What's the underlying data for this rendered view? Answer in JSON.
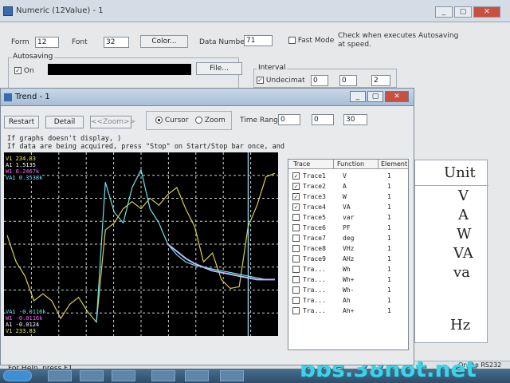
{
  "numeric_window": {
    "title": "Numeric (12Value) - 1",
    "win_buttons": [
      "_",
      "▢",
      "✕"
    ],
    "font_label": "Font",
    "font_value": "32",
    "form_label": "Form",
    "form_value": "12",
    "color_button": "Color...",
    "data_number_label": "Data Number",
    "data_number_value": "71",
    "fast_mode_label": "Fast Mode",
    "autosave_note": "Check when executes Autosaving at speed.",
    "autosaving_group": "Autosaving",
    "autosave_check_label": "On",
    "file_button": "File...",
    "interval_group": "Interval",
    "undecimated_label": "Undecimat",
    "interval_values": [
      "0",
      "0",
      "2"
    ],
    "unit_header": "Unit",
    "units": [
      "V",
      "A",
      "W",
      "VA",
      "va",
      "Hz"
    ],
    "status_help": "For Help, press F1",
    "status_online": "Online",
    "status_port": "RS232"
  },
  "trend_window": {
    "title": "Trend - 1",
    "buttons": {
      "restart": "Restart",
      "detail": "Detail",
      "zoom": "<<Zoom>>"
    },
    "mode": {
      "cursor": "Cursor",
      "zoom": "Zoom",
      "selected": "cursor"
    },
    "time_range_label": "Time Range",
    "time_range_values": [
      "0",
      "0",
      "30"
    ],
    "hint_line1": "If graphs doesn't display, )",
    "hint_line2": "If data are being acquired,  press \"Stop\" on Start/Stop bar once, and",
    "readouts_top": [
      {
        "text": "V1 234.83",
        "color": "#f2ee5a"
      },
      {
        "text": "A1 1.5135",
        "color": "#ffffff"
      },
      {
        "text": "W1 0.2467k",
        "color": "#ff66ff"
      },
      {
        "text": "VA1 0.3538k",
        "color": "#6ee8ff"
      }
    ],
    "readouts_bottom": [
      {
        "text": "VA1 -0.0116k",
        "color": "#6ee8ff"
      },
      {
        "text": "W1 -0.0116k",
        "color": "#ff66ff"
      },
      {
        "text": "A1 -0.0124",
        "color": "#ffffff"
      },
      {
        "text": "V1 233.83",
        "color": "#f2ee5a"
      }
    ],
    "trace_table": {
      "headers": [
        "Trace",
        "Function",
        "Element"
      ],
      "rows": [
        {
          "trace": "Trace1",
          "function": "V",
          "element": "1",
          "checked": true
        },
        {
          "trace": "Trace2",
          "function": "A",
          "element": "1",
          "checked": true
        },
        {
          "trace": "Trace3",
          "function": "W",
          "element": "1",
          "checked": true
        },
        {
          "trace": "Trace4",
          "function": "VA",
          "element": "1",
          "checked": true
        },
        {
          "trace": "Trace5",
          "function": "var",
          "element": "1",
          "checked": false
        },
        {
          "trace": "Trace6",
          "function": "PF",
          "element": "1",
          "checked": false
        },
        {
          "trace": "Trace7",
          "function": "deg",
          "element": "1",
          "checked": false
        },
        {
          "trace": "Trace8",
          "function": "VHz",
          "element": "1",
          "checked": false
        },
        {
          "trace": "Trace9",
          "function": "AHz",
          "element": "1",
          "checked": false
        },
        {
          "trace": "Tra...",
          "function": "Wh",
          "element": "1",
          "checked": false
        },
        {
          "trace": "Tra...",
          "function": "Wh+",
          "element": "1",
          "checked": false
        },
        {
          "trace": "Tra...",
          "function": "Wh-",
          "element": "1",
          "checked": false
        },
        {
          "trace": "Tra...",
          "function": "Ah",
          "element": "1",
          "checked": false
        },
        {
          "trace": "Tra...",
          "function": "Ah+",
          "element": "1",
          "checked": false
        }
      ]
    }
  },
  "chart_data": {
    "type": "line",
    "title": "",
    "xlabel": "",
    "ylabel": "",
    "x": [
      0,
      1,
      2,
      3,
      4,
      5,
      6,
      7,
      8,
      9,
      10,
      11,
      12,
      13,
      14,
      15,
      16,
      17,
      18,
      19,
      20,
      21,
      22,
      23,
      24,
      25,
      26,
      27,
      28,
      29,
      30
    ],
    "ylim": [
      0,
      100
    ],
    "grid": true,
    "series": [
      {
        "name": "",
        "color": "#d8d04a",
        "values": [
          55,
          40,
          32,
          18,
          22,
          18,
          8,
          16,
          20,
          12,
          6,
          58,
          62,
          70,
          74,
          70,
          76,
          72,
          78,
          82,
          70,
          60,
          40,
          45,
          30,
          25,
          26,
          60,
          72,
          88,
          90
        ]
      },
      {
        "name": "",
        "color": "#6fe0e8",
        "values": [
          null,
          null,
          null,
          null,
          null,
          null,
          null,
          null,
          null,
          null,
          6,
          85,
          68,
          62,
          82,
          92,
          70,
          62,
          50,
          44,
          40,
          38,
          37,
          36,
          35,
          34,
          33,
          32,
          31,
          30,
          30
        ]
      },
      {
        "name": "",
        "color": "#b8b8ff",
        "values": [
          null,
          null,
          null,
          null,
          null,
          null,
          null,
          null,
          null,
          null,
          null,
          null,
          null,
          null,
          null,
          null,
          null,
          null,
          50,
          46,
          42,
          39,
          37,
          35,
          34,
          33,
          32,
          31,
          30,
          30,
          30
        ]
      }
    ],
    "cursor_x": 27
  }
}
